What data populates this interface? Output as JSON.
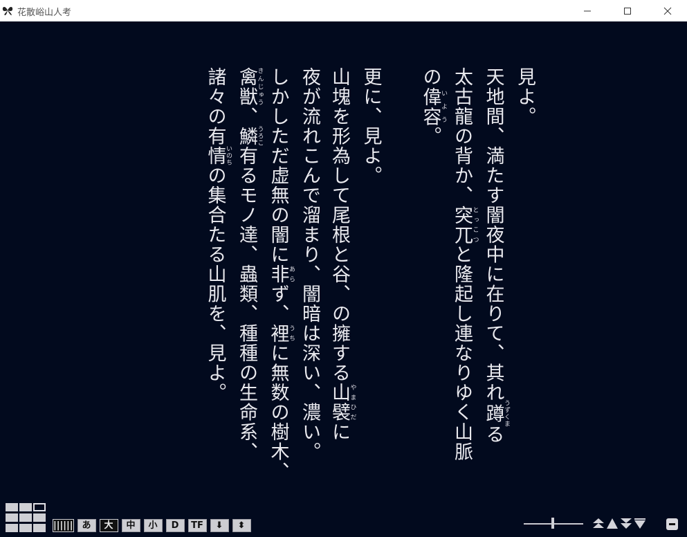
{
  "window": {
    "title": "花散峪山人考",
    "controls": {
      "minimize": "—",
      "maximize": "☐",
      "close": "✕"
    }
  },
  "text": {
    "lines": [
      {
        "segments": [
          {
            "t": "見よ。"
          }
        ]
      },
      {
        "segments": [
          {
            "t": "天地間、満たす闇夜中に在りて、其れ"
          },
          {
            "rb": "蹲",
            "rt": "うずくま"
          },
          {
            "t": "る"
          }
        ]
      },
      {
        "segments": [
          {
            "t": "太古龍の背か、"
          },
          {
            "rb": "突兀",
            "rt": "とっこつ"
          },
          {
            "t": "と隆起し連なりゆく山脈"
          }
        ]
      },
      {
        "segments": [
          {
            "t": "の"
          },
          {
            "rb": "偉容",
            "rt": "いよう"
          },
          {
            "t": "。"
          }
        ]
      },
      {
        "gap": true
      },
      {
        "segments": [
          {
            "t": "更に、見よ。"
          }
        ]
      },
      {
        "segments": [
          {
            "t": "山塊を形為して尾根と谷、の擁する"
          },
          {
            "rb": "山襞",
            "rt": "やまひだ"
          },
          {
            "t": "に"
          }
        ]
      },
      {
        "segments": [
          {
            "t": "夜が流れこんで溜まり、闇暗は深い、濃い。"
          }
        ]
      },
      {
        "segments": [
          {
            "t": "しかしただ虚無の闇に"
          },
          {
            "rb": "非",
            "rt": "あら"
          },
          {
            "t": "ず、"
          },
          {
            "rb": "裡",
            "rt": "うち"
          },
          {
            "t": "に無数の樹木、"
          }
        ]
      },
      {
        "segments": [
          {
            "rb": "禽獣",
            "rt": "きんじゅう"
          },
          {
            "t": "、"
          },
          {
            "rb": "鱗",
            "rt": "うろこ"
          },
          {
            "t": "有るモノ達、蟲類、種種の生命系、"
          }
        ]
      },
      {
        "segments": [
          {
            "t": "諸々の有"
          },
          {
            "rb": "情",
            "rt": "いのち"
          },
          {
            "t": "の集合たる山肌を、見よ。"
          }
        ]
      }
    ]
  },
  "toolbar": {
    "buttons": [
      {
        "name": "line-mode-button",
        "label": "||||||",
        "dark": true
      },
      {
        "name": "kana-button",
        "label": "あ",
        "dark": false
      },
      {
        "name": "font-large-button",
        "label": "大",
        "dark": true
      },
      {
        "name": "font-medium-button",
        "label": "中",
        "dark": false
      },
      {
        "name": "font-small-button",
        "label": "小",
        "dark": false
      },
      {
        "name": "display-button",
        "label": "D",
        "dark": false
      },
      {
        "name": "tf-button",
        "label": "TF",
        "dark": false
      },
      {
        "name": "scroll-down-button",
        "label": "⬇",
        "dark": false
      },
      {
        "name": "scroll-double-button",
        "label": "⬍",
        "dark": false
      }
    ],
    "nav": [
      "page-first-icon",
      "page-prev-icon",
      "page-next-icon",
      "page-last-icon"
    ]
  },
  "colors": {
    "background": "#020a1e",
    "text": "#e9e9ee",
    "ui": "#cdcdd2"
  }
}
